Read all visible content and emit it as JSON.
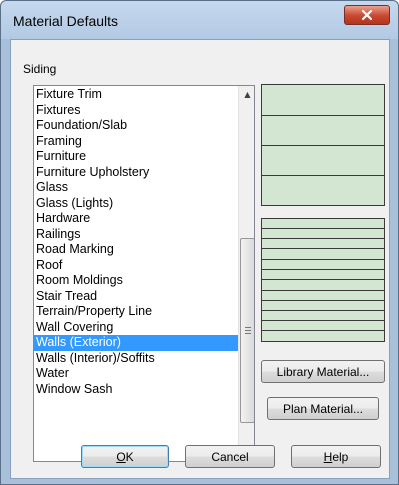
{
  "window": {
    "title": "Material Defaults",
    "close_glyph": "✕"
  },
  "section_label": "Siding",
  "list": {
    "items": [
      "Fixture Trim",
      "Fixtures",
      "Foundation/Slab",
      "Framing",
      "Furniture",
      "Furniture Upholstery",
      "Glass",
      "Glass (Lights)",
      "Hardware",
      "Railings",
      "Road Marking",
      "Roof",
      "Room Moldings",
      "Stair Tread",
      "Terrain/Property Line",
      "Wall Covering",
      "Walls (Exterior)",
      "Walls (Interior)/Soffits",
      "Water",
      "Window Sash"
    ],
    "selected": "Walls (Exterior)",
    "scroll_up": "▲",
    "scroll_down": "▼"
  },
  "buttons": {
    "library_material": "Library Material...",
    "plan_material": "Plan Material...",
    "ok_mnemonic": "O",
    "ok_rest": "K",
    "cancel": "Cancel",
    "help_mnemonic": "H",
    "help_rest": "elp"
  },
  "colors": {
    "selection": "#3399ff",
    "preview_fill": "#d2e6d2",
    "close_button": "#c8472f"
  }
}
